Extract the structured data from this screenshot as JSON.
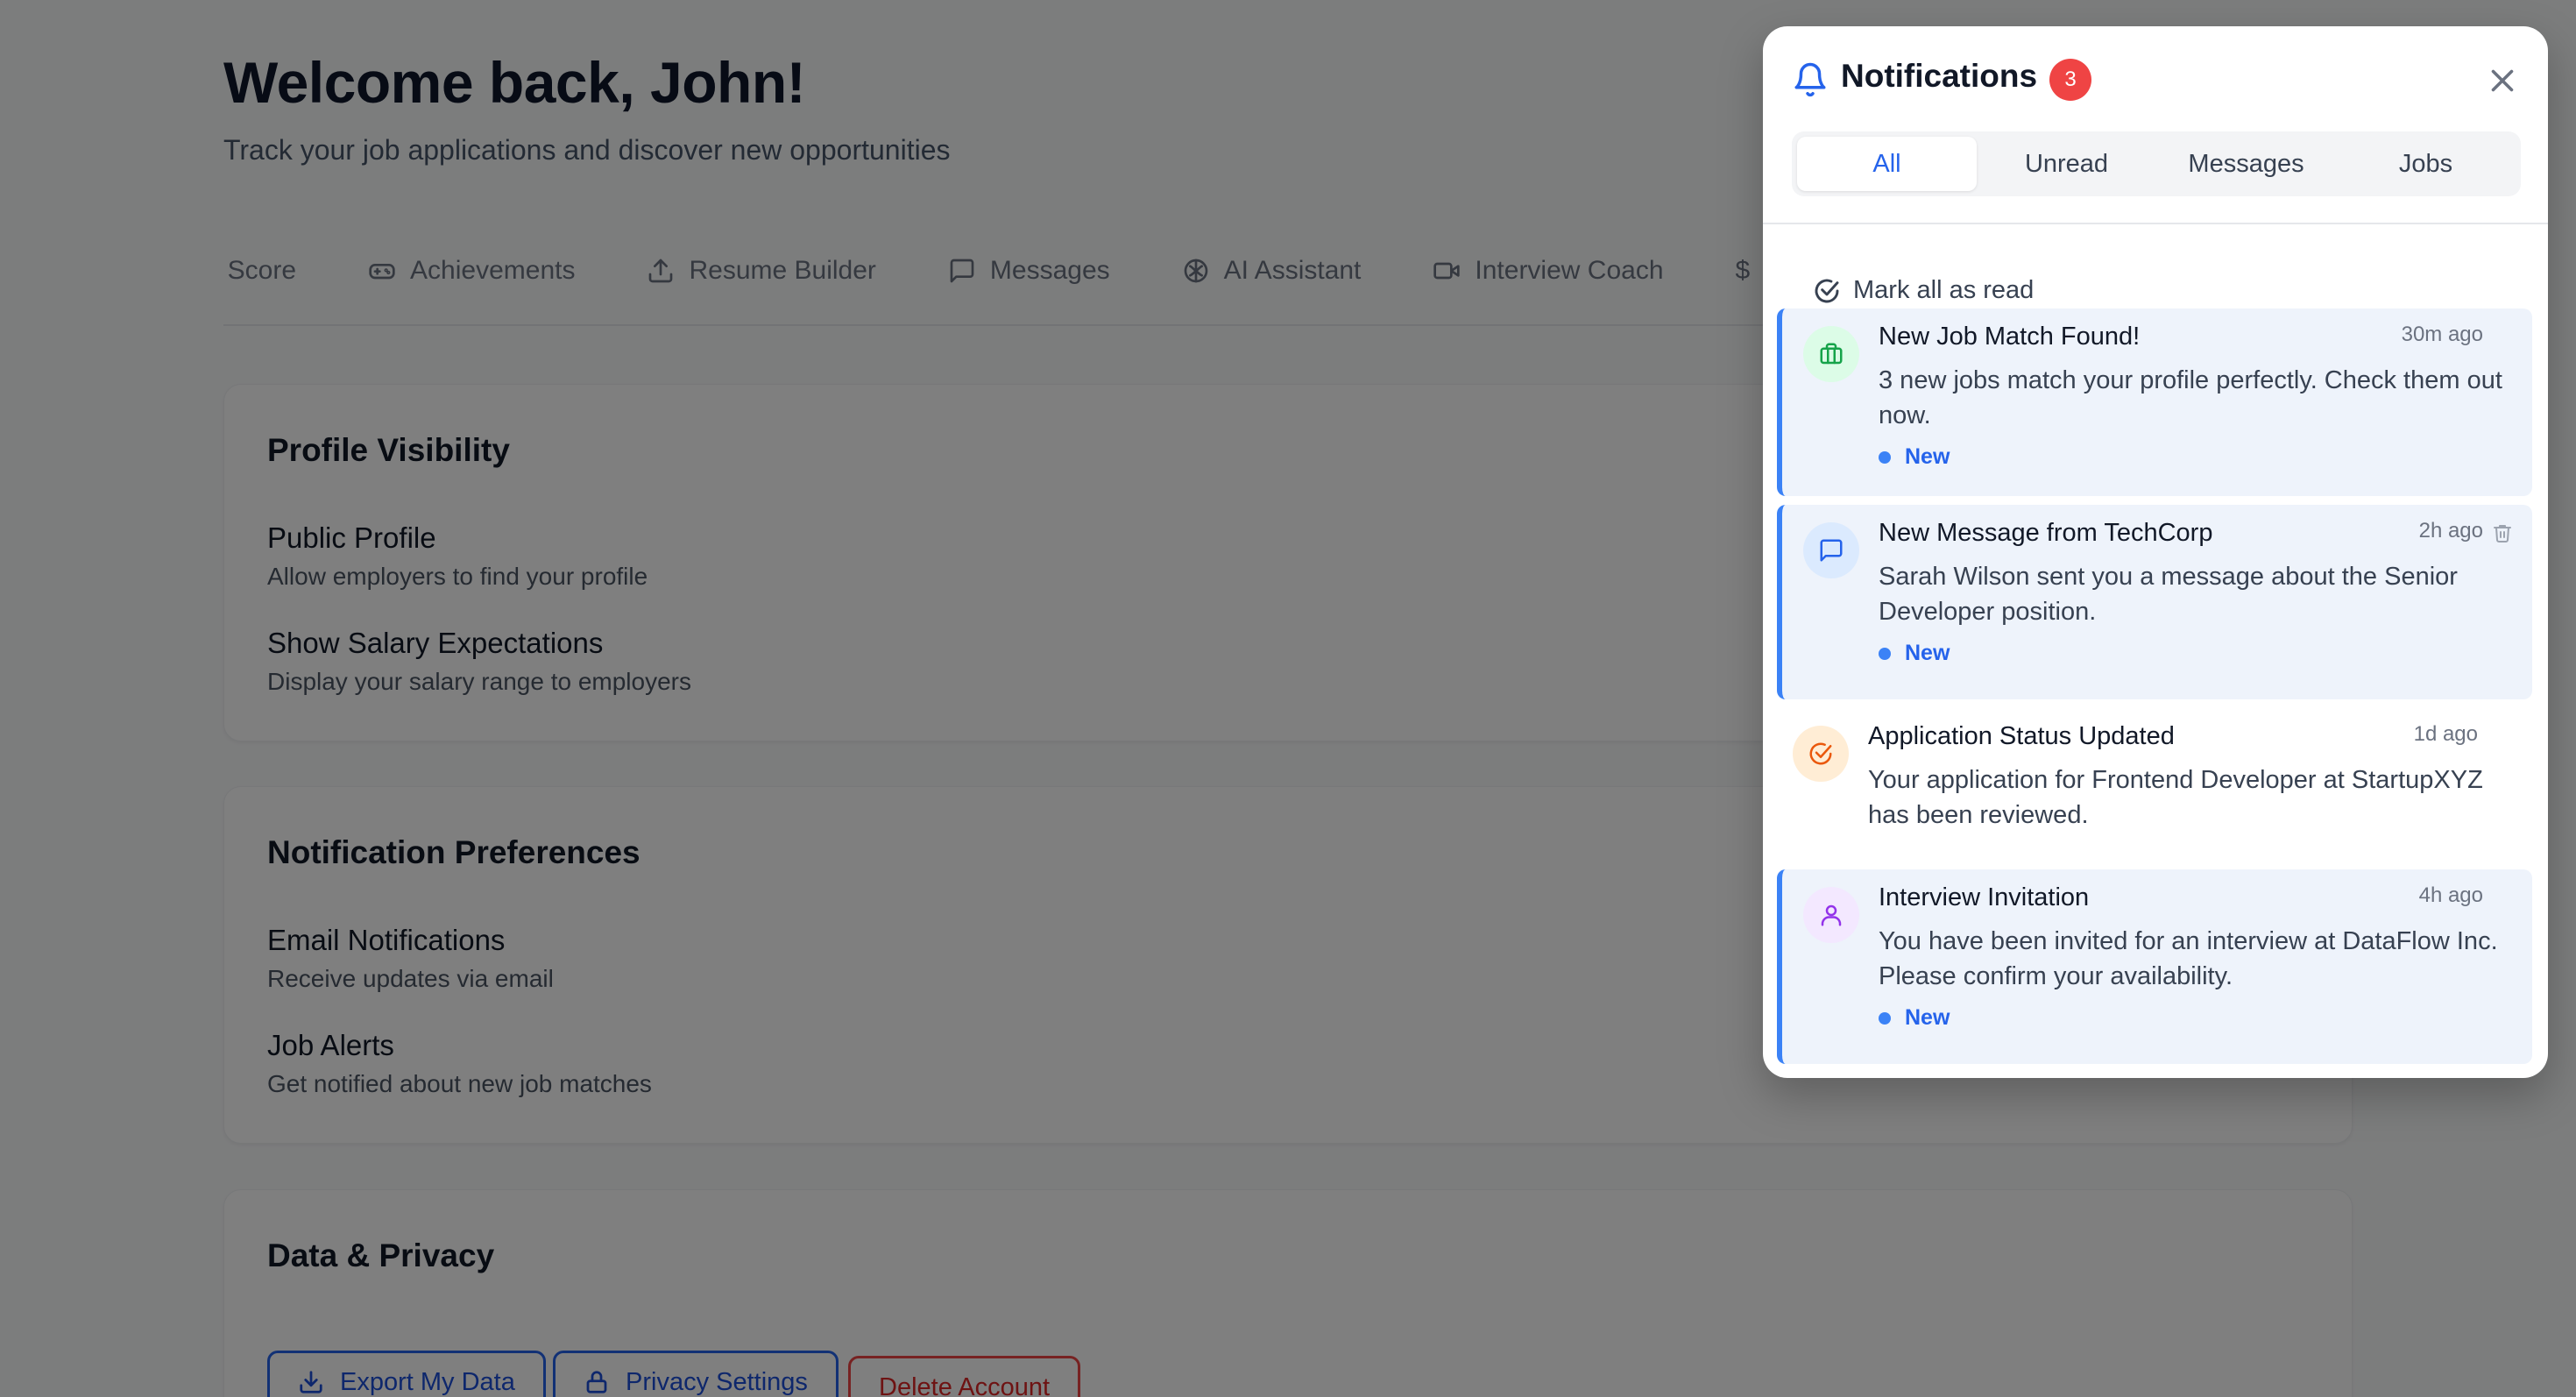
{
  "page": {
    "title": "Welcome back, John!",
    "subtitle": "Track your job applications and discover new opportunities"
  },
  "tabs": [
    {
      "label": "t Score",
      "icon": "score-icon"
    },
    {
      "label": "Achievements",
      "icon": "gamepad-icon"
    },
    {
      "label": "Resume Builder",
      "icon": "upload-icon"
    },
    {
      "label": "Messages",
      "icon": "message-icon"
    },
    {
      "label": "AI Assistant",
      "icon": "brain-icon"
    },
    {
      "label": "Interview Coach",
      "icon": "video-icon"
    },
    {
      "label": "$",
      "icon": "dollar-icon"
    }
  ],
  "profile_visibility": {
    "title": "Profile Visibility",
    "settings": [
      {
        "label": "Public Profile",
        "desc": "Allow employers to find your profile"
      },
      {
        "label": "Show Salary Expectations",
        "desc": "Display your salary range to employers"
      }
    ]
  },
  "notification_prefs": {
    "title": "Notification Preferences",
    "settings": [
      {
        "label": "Email Notifications",
        "desc": "Receive updates via email"
      },
      {
        "label": "Job Alerts",
        "desc": "Get notified about new job matches"
      }
    ]
  },
  "data_privacy": {
    "title": "Data & Privacy",
    "export_label": "Export My Data",
    "privacy_label": "Privacy Settings",
    "delete_label": "Delete Account"
  },
  "panel": {
    "title": "Notifications",
    "count": "3",
    "filters": [
      "All",
      "Unread",
      "Messages",
      "Jobs"
    ],
    "active_filter": "All",
    "mark_all": "Mark all as read",
    "items": [
      {
        "title": "New Job Match Found!",
        "time": "30m ago",
        "body": "3 new jobs match your profile perfectly. Check them out now.",
        "badge": "New",
        "unread": true,
        "icon": "briefcase-icon"
      },
      {
        "title": "New Message from TechCorp",
        "time": "2h ago",
        "body": "Sarah Wilson sent you a message about the Senior Developer position.",
        "badge": "New",
        "unread": true,
        "icon": "message-icon"
      },
      {
        "title": "Application Status Updated",
        "time": "1d ago",
        "body": "Your application for Frontend Developer at StartupXYZ has been reviewed.",
        "badge": "",
        "unread": false,
        "icon": "check-circle-icon"
      },
      {
        "title": "Interview Invitation",
        "time": "4h ago",
        "body": "You have been invited for an interview at DataFlow Inc. Please confirm your availability.",
        "badge": "New",
        "unread": true,
        "icon": "user-icon"
      }
    ]
  },
  "colors": {
    "accent": "#2563eb",
    "badge_red": "#ef4444",
    "job_icon": "#16a34a",
    "status_icon": "#ea580c",
    "interview_icon": "#9333ea"
  }
}
